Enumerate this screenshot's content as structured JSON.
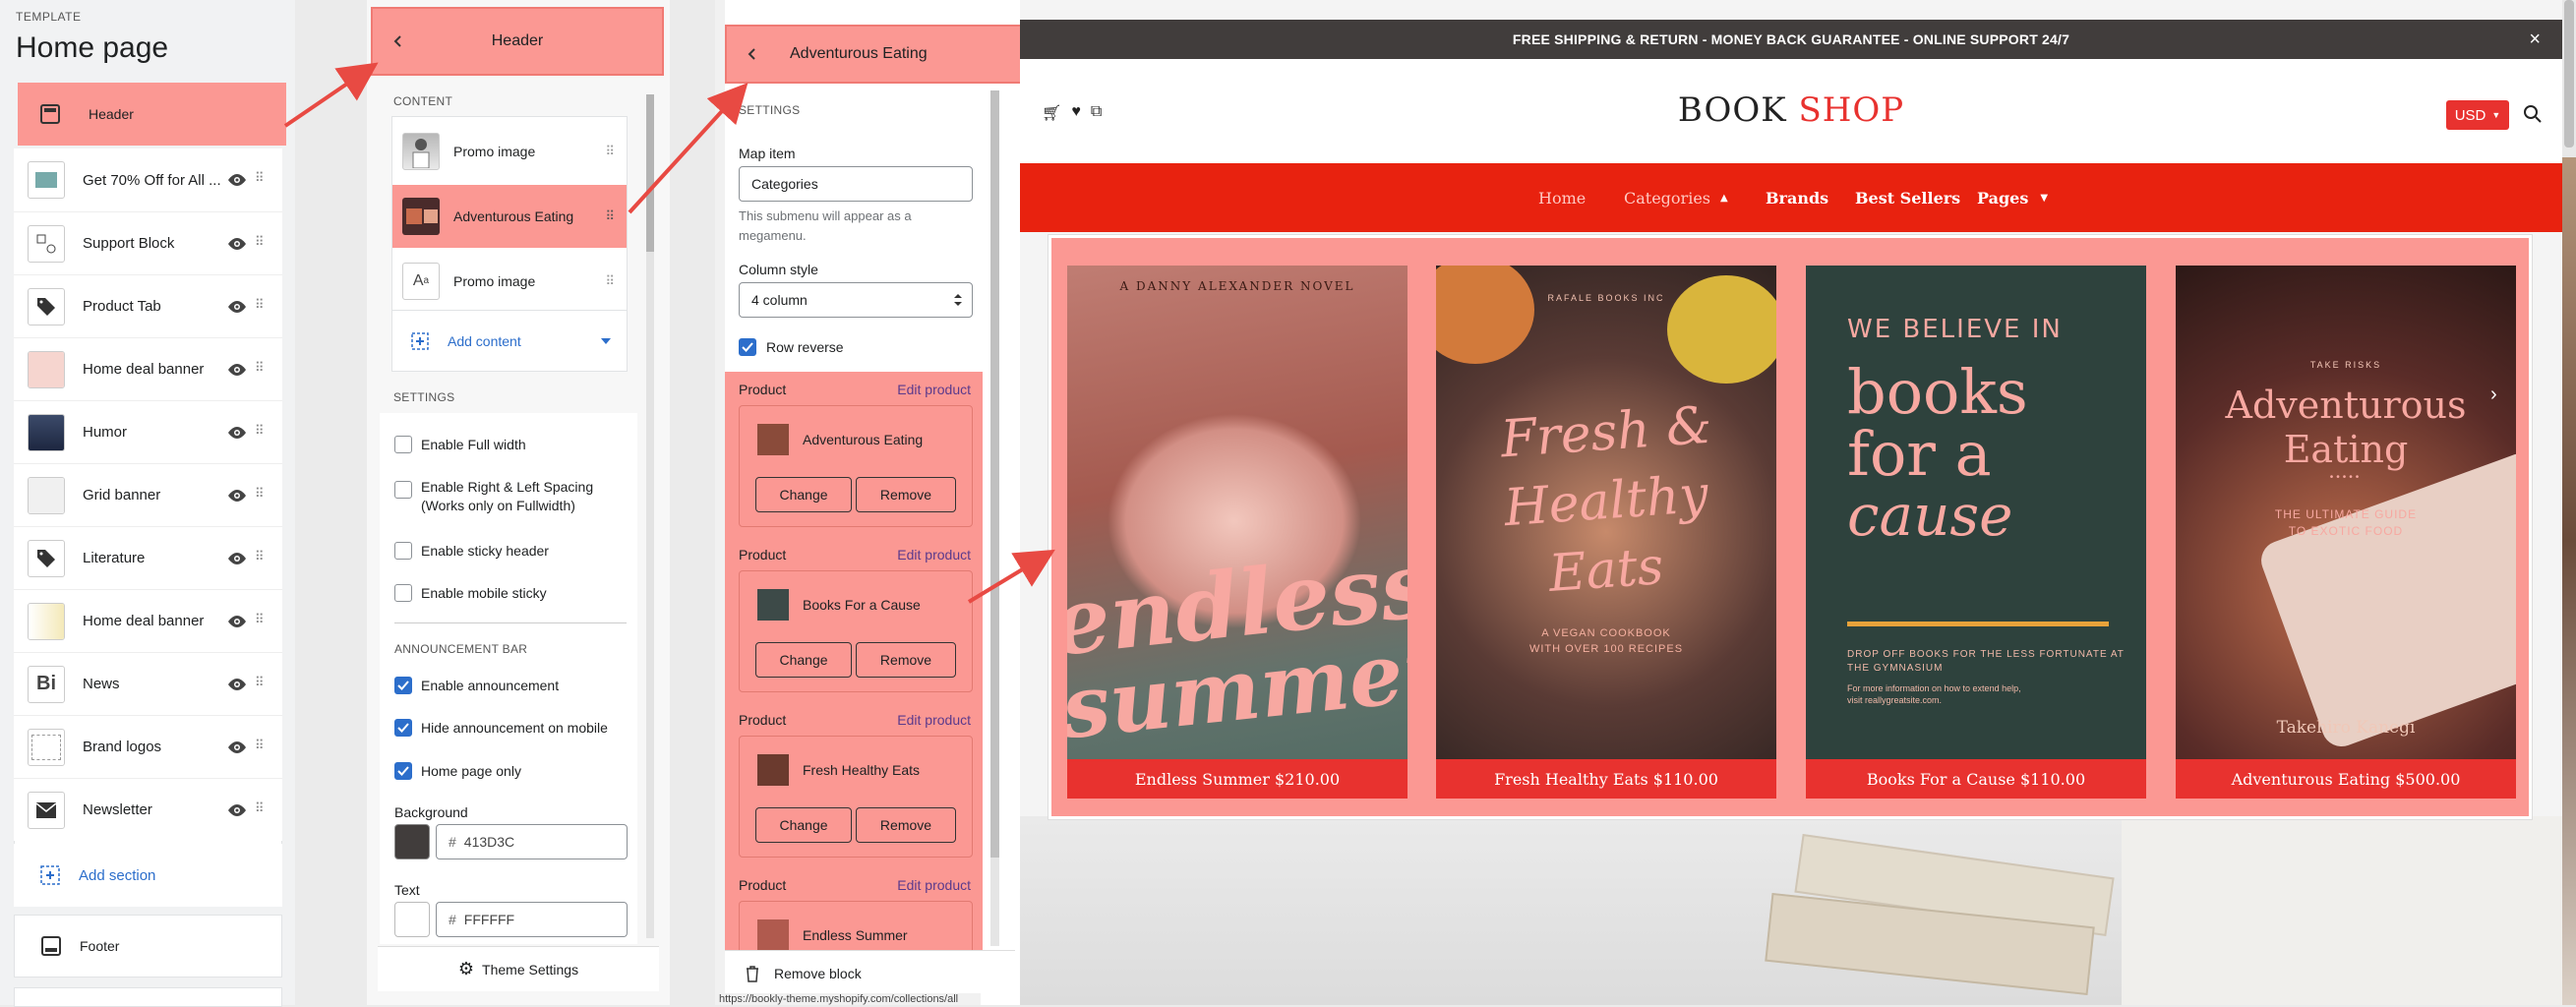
{
  "panel1": {
    "template_label": "TEMPLATE",
    "title": "Home page",
    "header_item": "Header",
    "items": [
      {
        "label": "Get 70% Off for All ..."
      },
      {
        "label": "Support Block"
      },
      {
        "label": "Product Tab"
      },
      {
        "label": "Home deal banner"
      },
      {
        "label": "Humor"
      },
      {
        "label": "Grid banner"
      },
      {
        "label": "Literature"
      },
      {
        "label": "Home deal banner"
      },
      {
        "label": "News"
      },
      {
        "label": "Brand logos"
      },
      {
        "label": "Newsletter"
      }
    ],
    "add_section": "Add section",
    "footer": "Footer"
  },
  "panel2": {
    "title": "Header",
    "content_label": "CONTENT",
    "blocks": [
      "Promo image",
      "Adventurous Eating",
      "Promo image"
    ],
    "add_content": "Add content",
    "settings_label": "SETTINGS",
    "checks": [
      {
        "label": "Enable Full width",
        "checked": false
      },
      {
        "label": "Enable Right & Left Spacing",
        "sub": "(Works only on Fullwidth)",
        "checked": false
      },
      {
        "label": "Enable sticky header",
        "checked": false
      },
      {
        "label": "Enable mobile sticky",
        "checked": false
      }
    ],
    "announcement_label": "ANNOUNCEMENT BAR",
    "ann_checks": [
      {
        "label": "Enable announcement",
        "checked": true
      },
      {
        "label": "Hide announcement on mobile",
        "checked": true
      },
      {
        "label": "Home page only",
        "checked": true
      }
    ],
    "background_label": "Background",
    "background_value": "413D3C",
    "background_color": "#413D3C",
    "text_label": "Text",
    "text_value": "FFFFFF",
    "theme_settings": "Theme Settings"
  },
  "panel3": {
    "title": "Adventurous Eating",
    "settings_label": "SETTINGS",
    "map_item_label": "Map item",
    "map_item_value": "Categories",
    "map_help": "This submenu will appear as a megamenu.",
    "column_style_label": "Column style",
    "column_style_value": "4 column",
    "row_reverse": "Row reverse",
    "product_label": "Product",
    "edit_product": "Edit product",
    "change": "Change",
    "remove": "Remove",
    "products": [
      "Adventurous Eating",
      "Books For a Cause",
      "Fresh Healthy Eats",
      "Endless Summer"
    ],
    "remove_block": "Remove block",
    "status_url": "https://bookly-theme.myshopify.com/collections/all"
  },
  "preview": {
    "announcement": "FREE SHIPPING & RETURN - MONEY BACK GUARANTEE - ONLINE SUPPORT 24/7",
    "logo_part1": "BOOK",
    "logo_part2": "SHOP",
    "currency": "USD",
    "nav": [
      "Home",
      "Categories",
      "Brands",
      "Best Sellers",
      "Pages"
    ],
    "books": [
      {
        "caption": "Endless Summer $210.00",
        "top": "A DANNY ALEXANDER NOVEL",
        "cover_l1": "endless",
        "cover_l2": "summer"
      },
      {
        "caption": "Fresh Healthy Eats $110.00",
        "top": "RAFALE BOOKS INC",
        "cover_l1": "Fresh &",
        "cover_l2": "Healthy",
        "cover_l3": "Eats",
        "sub1": "A VEGAN COOKBOOK",
        "sub2": "WITH OVER 100 RECIPES"
      },
      {
        "caption": "Books For a Cause $110.00",
        "top": "WE BELIEVE IN",
        "cover_l1": "books",
        "cover_l2": "for a",
        "cover_l3": "cause",
        "sub1": "DROP OFF BOOKS FOR THE LESS FORTUNATE AT",
        "sub2": "THE GYMNASIUM",
        "sub3": "For more information on how to extend help,",
        "sub4": "visit reallygreatsite.com."
      },
      {
        "caption": "Adventurous Eating $500.00",
        "top": "TAKE RISKS",
        "cover_l1": "Adventurous",
        "cover_l2": "Eating",
        "sub1": "THE ULTIMATE GUIDE",
        "sub2": "TO EXOTIC FOOD",
        "author": "Takehiro Kanegi"
      }
    ]
  },
  "colors": {
    "accent_red": "#e8322f",
    "highlight": "#fb9893",
    "announce_bg": "#413d3c",
    "link_blue": "#2c6ecb"
  }
}
